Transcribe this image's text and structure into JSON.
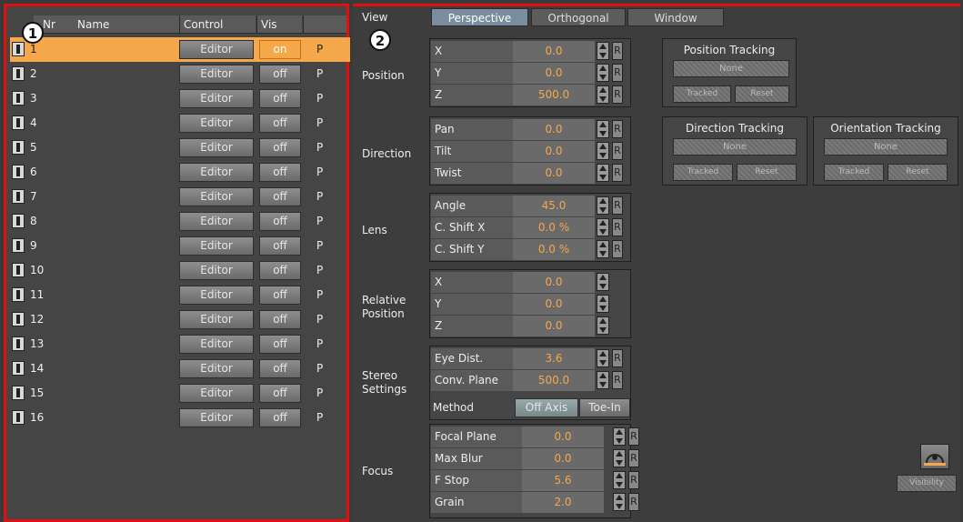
{
  "badges": {
    "left": "1",
    "right": "2"
  },
  "left": {
    "columns": {
      "nr": "Nr",
      "name": "Name",
      "control": "Control",
      "vis": "Vis"
    },
    "rows": [
      {
        "nr": "1",
        "control": "Editor",
        "vis": "on",
        "p": "P"
      },
      {
        "nr": "2",
        "control": "Editor",
        "vis": "off",
        "p": "P"
      },
      {
        "nr": "3",
        "control": "Editor",
        "vis": "off",
        "p": "P"
      },
      {
        "nr": "4",
        "control": "Editor",
        "vis": "off",
        "p": "P"
      },
      {
        "nr": "5",
        "control": "Editor",
        "vis": "off",
        "p": "P"
      },
      {
        "nr": "6",
        "control": "Editor",
        "vis": "off",
        "p": "P"
      },
      {
        "nr": "7",
        "control": "Editor",
        "vis": "off",
        "p": "P"
      },
      {
        "nr": "8",
        "control": "Editor",
        "vis": "off",
        "p": "P"
      },
      {
        "nr": "9",
        "control": "Editor",
        "vis": "off",
        "p": "P"
      },
      {
        "nr": "10",
        "control": "Editor",
        "vis": "off",
        "p": "P"
      },
      {
        "nr": "11",
        "control": "Editor",
        "vis": "off",
        "p": "P"
      },
      {
        "nr": "12",
        "control": "Editor",
        "vis": "off",
        "p": "P"
      },
      {
        "nr": "13",
        "control": "Editor",
        "vis": "off",
        "p": "P"
      },
      {
        "nr": "14",
        "control": "Editor",
        "vis": "off",
        "p": "P"
      },
      {
        "nr": "15",
        "control": "Editor",
        "vis": "off",
        "p": "P"
      },
      {
        "nr": "16",
        "control": "Editor",
        "vis": "off",
        "p": "P"
      }
    ]
  },
  "right": {
    "view_label": "View",
    "tabs": [
      "Perspective",
      "Orthogonal",
      "Window"
    ],
    "position": {
      "label": "Position",
      "fields": [
        {
          "l": "X",
          "v": "0.0"
        },
        {
          "l": "Y",
          "v": "0.0"
        },
        {
          "l": "Z",
          "v": "500.0"
        }
      ]
    },
    "direction": {
      "label": "Direction",
      "fields": [
        {
          "l": "Pan",
          "v": "0.0"
        },
        {
          "l": "Tilt",
          "v": "0.0"
        },
        {
          "l": "Twist",
          "v": "0.0"
        }
      ]
    },
    "lens": {
      "label": "Lens",
      "fields": [
        {
          "l": "Angle",
          "v": "45.0"
        },
        {
          "l": "C. Shift X",
          "v": "0.0 %"
        },
        {
          "l": "C. Shift Y",
          "v": "0.0 %"
        }
      ]
    },
    "relpos": {
      "label1": "Relative",
      "label2": "Position",
      "fields": [
        {
          "l": "X",
          "v": "0.0"
        },
        {
          "l": "Y",
          "v": "0.0"
        },
        {
          "l": "Z",
          "v": "0.0"
        }
      ]
    },
    "stereo": {
      "label1": "Stereo",
      "label2": "Settings",
      "fields": [
        {
          "l": "Eye Dist.",
          "v": "3.6"
        },
        {
          "l": "Conv. Plane",
          "v": "500.0"
        }
      ],
      "method_label": "Method",
      "method_opts": [
        "Off Axis",
        "Toe-In"
      ]
    },
    "focus": {
      "label": "Focus",
      "fields": [
        {
          "l": "Focal Plane",
          "v": "0.0"
        },
        {
          "l": "Max Blur",
          "v": "0.0"
        },
        {
          "l": "F Stop",
          "v": "5.6"
        },
        {
          "l": "Grain",
          "v": "2.0"
        }
      ]
    },
    "r_label": "R",
    "tracking": {
      "position": {
        "title": "Position Tracking",
        "none": "None",
        "tracked": "Tracked",
        "reset": "Reset"
      },
      "direction": {
        "title": "Direction Tracking",
        "none": "None",
        "tracked": "Tracked",
        "reset": "Reset"
      },
      "orientation": {
        "title": "Orientation Tracking",
        "none": "None",
        "tracked": "Tracked",
        "reset": "Reset"
      }
    },
    "viz_button": "Visibility"
  },
  "colors": {
    "border": "#e01010",
    "selected": "#f5a84a",
    "value": "#f5a84a"
  }
}
